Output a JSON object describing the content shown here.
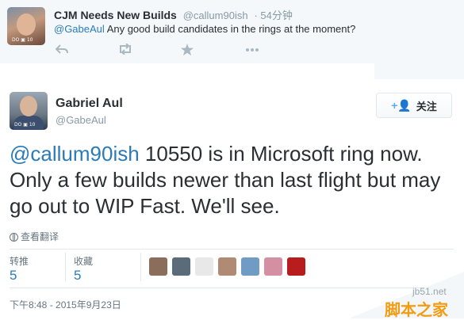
{
  "reply": {
    "name": "CJM Needs New Builds",
    "handle": "@callum90ish",
    "time": "· 54分钟",
    "mention": "@GabeAul",
    "text": " Any good build candidates in the rings at the moment?",
    "avatar_tag": "DO ▣ 10"
  },
  "tweet": {
    "name": "Gabriel Aul",
    "handle": "@GabeAul",
    "avatar_tag": "DO ▣ 10",
    "follow_icon": "+👤",
    "follow_label": "关注",
    "mention": "@callum90ish",
    "text": " 10550 is in Microsoft ring now. Only a few builds newer than last flight but may go out to WIP Fast. We'll see.",
    "translate": "查看翻译",
    "retweets_label": "转推",
    "retweets": "5",
    "favorites_label": "收藏",
    "favorites": "5",
    "timestamp": "下午8:48 - 2015年9月23日"
  },
  "icons": {
    "reply": "reply-arrow-icon",
    "retweet": "retweet-icon",
    "favorite": "star-icon",
    "more": "more-dots-icon",
    "follow": "add-user-icon",
    "translate": "globe-icon"
  },
  "favoriters": [
    {
      "name": "favoriter-avatar-1",
      "color": "#8a6d5b"
    },
    {
      "name": "favoriter-avatar-2",
      "color": "#5a6b7a"
    },
    {
      "name": "favoriter-avatar-3",
      "color": "#e8e8e8"
    },
    {
      "name": "favoriter-avatar-4",
      "color": "#b08a72"
    },
    {
      "name": "favoriter-avatar-5",
      "color": "#6f9bc4"
    },
    {
      "name": "favoriter-avatar-6",
      "color": "#d48fa2"
    },
    {
      "name": "favoriter-avatar-7",
      "color": "#b81c1c"
    }
  ],
  "watermark": {
    "site": "jb51.net",
    "logo": "脚本之家"
  },
  "colors": {
    "link": "#2b7bb9",
    "muted": "#8899a6",
    "text": "#292f33",
    "accent": "#55acee"
  }
}
